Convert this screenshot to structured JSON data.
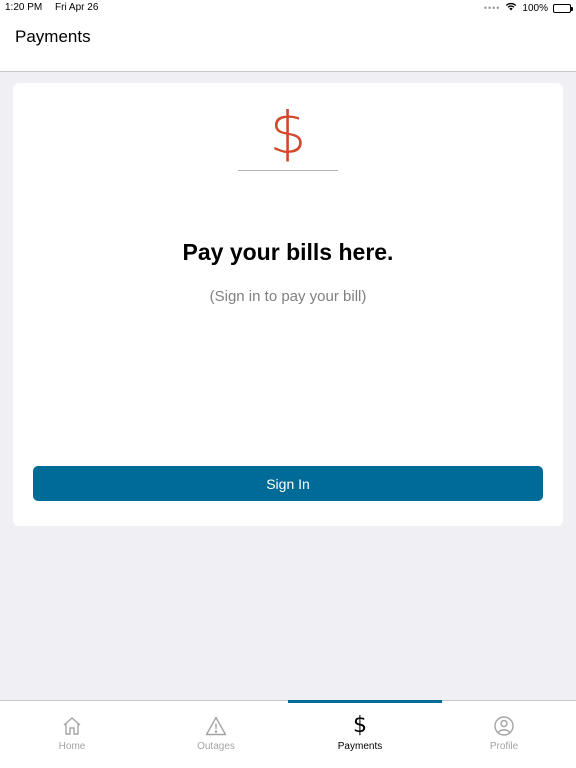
{
  "status_bar": {
    "time": "1:20 PM",
    "date": "Fri Apr 26",
    "battery": "100%"
  },
  "header": {
    "title": "Payments"
  },
  "card": {
    "icon": "dollar-icon",
    "icon_glyph": "$",
    "heading": "Pay your bills here.",
    "subtext": "(Sign in to pay your bill)",
    "sign_in_label": "Sign In"
  },
  "tabs": [
    {
      "label": "Home",
      "icon": "home-icon",
      "active": false
    },
    {
      "label": "Outages",
      "icon": "warning-icon",
      "active": false
    },
    {
      "label": "Payments",
      "icon": "dollar-icon",
      "active": true,
      "glyph": "$"
    },
    {
      "label": "Profile",
      "icon": "profile-icon",
      "active": false
    }
  ],
  "colors": {
    "accent": "#006b96",
    "dollar": "#d2482a",
    "inactive_tab": "#a4a4a4",
    "background": "#efeff4"
  }
}
